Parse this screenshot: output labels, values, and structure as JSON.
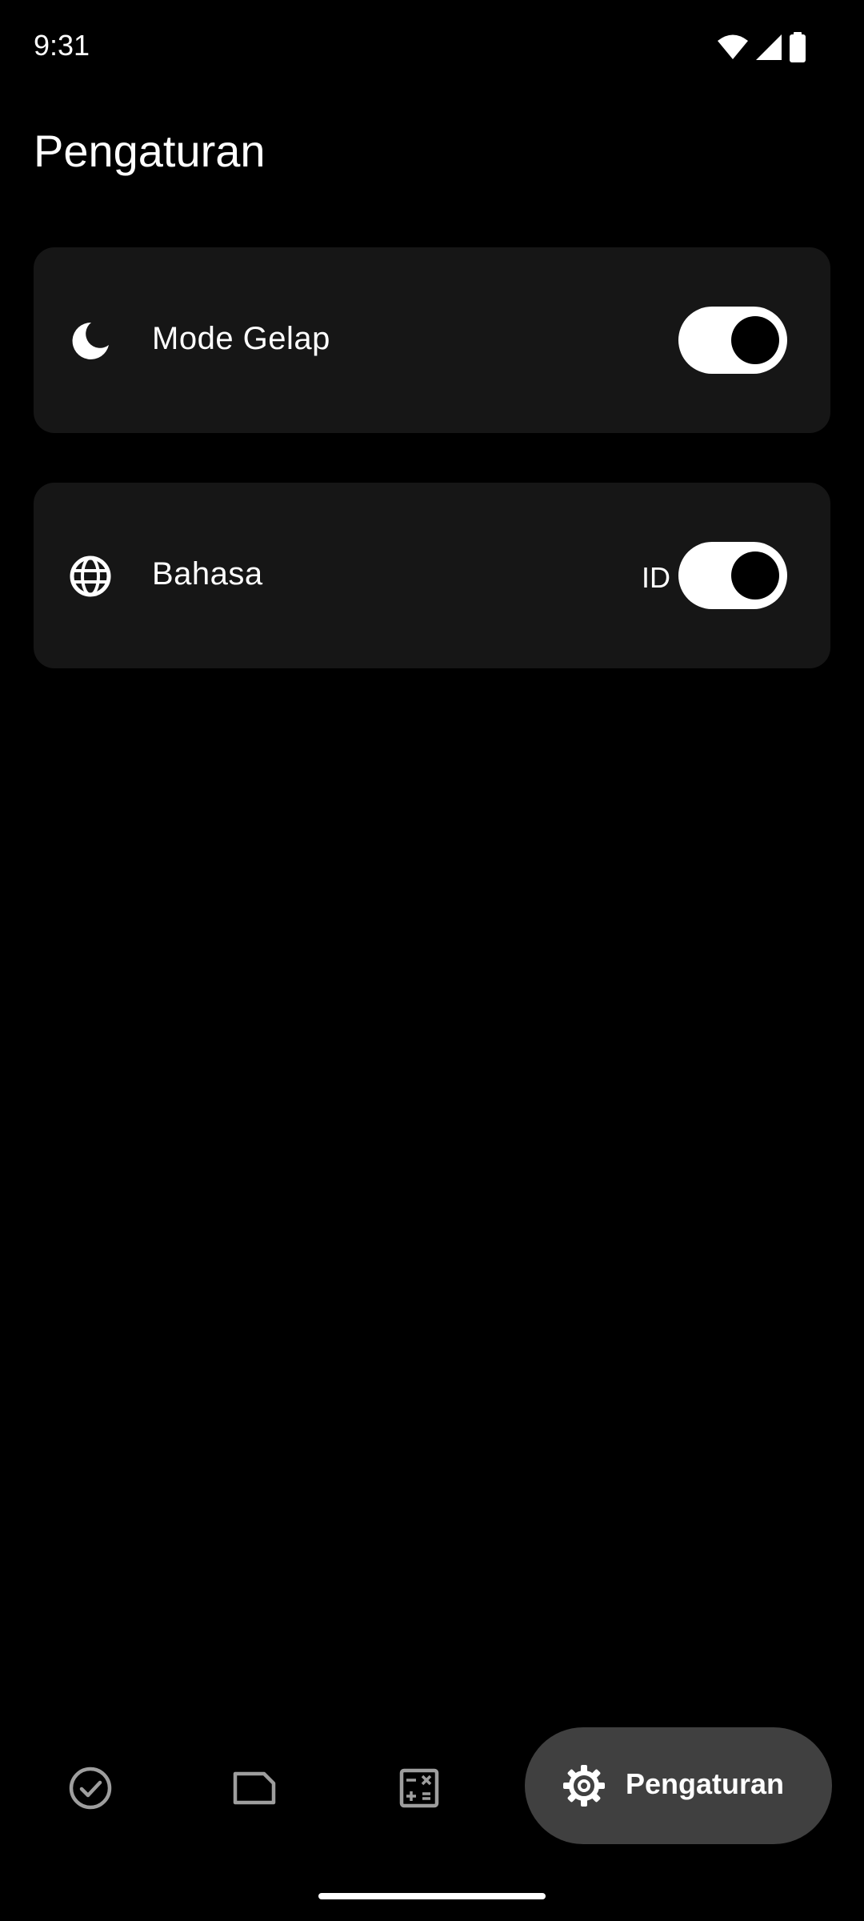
{
  "status_bar": {
    "time": "9:31",
    "icons": [
      "wifi-icon",
      "signal-icon",
      "battery-icon"
    ]
  },
  "page": {
    "title": "Pengaturan"
  },
  "settings": {
    "dark_mode": {
      "icon": "moon-icon",
      "label": "Mode Gelap",
      "enabled": true
    },
    "language": {
      "icon": "globe-icon",
      "label": "Bahasa",
      "value": "ID",
      "enabled": true
    }
  },
  "bottom_nav": {
    "items": [
      {
        "icon": "check-circle-icon"
      },
      {
        "icon": "note-icon"
      },
      {
        "icon": "calculator-icon"
      }
    ],
    "active": {
      "icon": "gear-icon",
      "label": "Pengaturan"
    }
  },
  "colors": {
    "background": "#000000",
    "card": "#161616",
    "active_nav": "#404040",
    "foreground": "#ffffff"
  }
}
